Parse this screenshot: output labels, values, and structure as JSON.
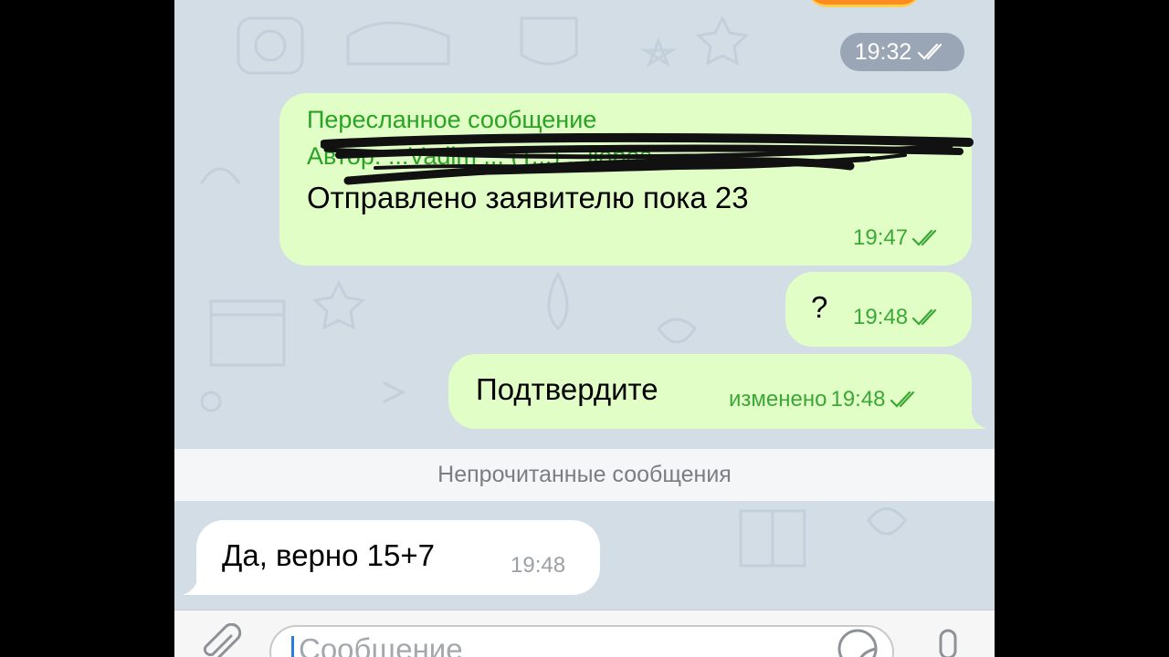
{
  "chat": {
    "top_time": "19:32",
    "messages": [
      {
        "forward_label": "Пересланное сообщение",
        "forward_author": "Автор: ...Vadim ... (Т...) ...ilopos",
        "text": "Отправлено заявителю пока 23",
        "time": "19:47"
      },
      {
        "text": "?",
        "time": "19:48"
      },
      {
        "text": "Подтвердите",
        "edited": "изменено",
        "time": "19:48"
      }
    ],
    "unread_divider": "Непрочитанные сообщения",
    "incoming": {
      "text": "Да, верно 15+7",
      "time": "19:48"
    }
  },
  "composer": {
    "placeholder": "Сообщение"
  },
  "colors": {
    "bubble_out": "#e1fec6",
    "bubble_in": "#ffffff",
    "accent_green": "#2aa324",
    "wallpaper": "#d3dde6"
  },
  "icons": {
    "read": "double-check-icon",
    "attach": "paperclip-icon",
    "sticker": "sticker-icon",
    "mic": "microphone-icon"
  }
}
